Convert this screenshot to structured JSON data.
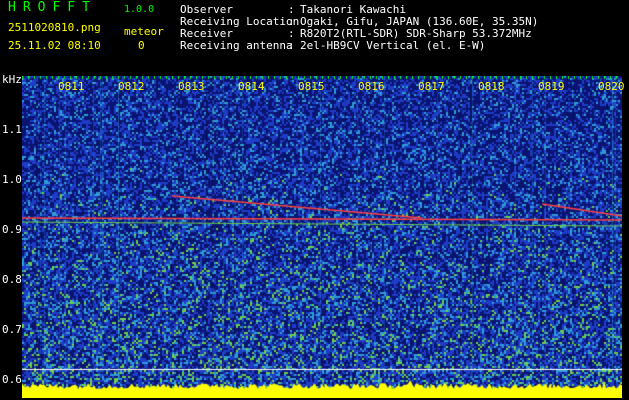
{
  "header": {
    "app_title": "HROFFT",
    "version": "1.0.0",
    "filename": "2511020810.png",
    "meteor_label": "meteor",
    "datetime": "25.11.02 08:10",
    "meteor_count": "0"
  },
  "meta": [
    {
      "key": "Observer",
      "value": "Takanori Kawachi"
    },
    {
      "key": "Receiving Location",
      "value": "Ogaki, Gifu, JAPAN (136.60E, 35.35N)"
    },
    {
      "key": "Receiver",
      "value": "R820T2(RTL-SDR) SDR-Sharp 53.372MHz"
    },
    {
      "key": "Receiving antenna",
      "value": "2el-HB9CV Vertical (el. E-W)"
    }
  ],
  "meta_separator": ":",
  "spectrogram": {
    "y_unit": "kHz",
    "y_labels": [
      "1.1",
      "1.0",
      "0.9",
      "0.8",
      "0.7",
      "0.6"
    ],
    "x_labels": [
      "0811",
      "0812",
      "0813",
      "0814",
      "0815",
      "0816",
      "0817",
      "0818",
      "0819",
      "0820"
    ],
    "colors": {
      "background": "#0a1470",
      "noise_low": "#1e3cc8",
      "noise_mid": "#2e9cd6",
      "noise_high": "#6ed04a",
      "signal": "#ff4040",
      "power_bar": "#ffff00",
      "ticks": "#00ff00"
    }
  }
}
